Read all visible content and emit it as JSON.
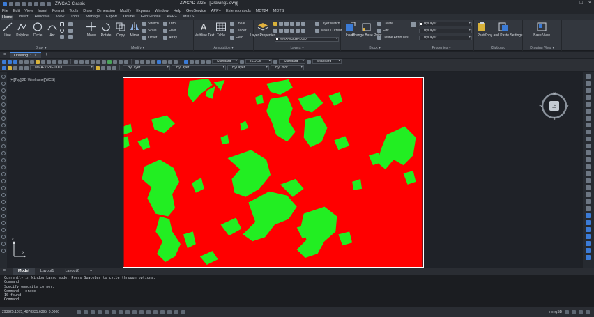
{
  "titlebar": {
    "workspace": "ZWCAD Classic",
    "title": "ZWCAD 2025 - [Drawing1.dwg]"
  },
  "menubar": [
    "File",
    "Edit",
    "View",
    "Insert",
    "Format",
    "Tools",
    "Draw",
    "Dimension",
    "Modify",
    "Express",
    "Window",
    "Help",
    "GeoService",
    "APP+",
    "Extensiontools",
    "MDT24",
    "MDTS"
  ],
  "ribbontabs": [
    "Home",
    "Insert",
    "Annotate",
    "View",
    "Tools",
    "Manage",
    "Export",
    "Online",
    "GeoService",
    "APP+",
    "MDTS"
  ],
  "ribbon": {
    "draw": {
      "label": "Draw",
      "buttons": [
        "Line",
        "Polyline",
        "Circle",
        "Arc"
      ]
    },
    "modify": {
      "label": "Modify",
      "big": [
        "Move",
        "Rotate",
        "Copy",
        "Mirror"
      ],
      "small": [
        "Stretch",
        "Scale",
        "Offset",
        "Trim",
        "Fillet",
        "Array"
      ]
    },
    "annotation": {
      "label": "Annotation",
      "big": [
        "Multiline Text",
        "Table"
      ],
      "small": [
        "Linear",
        "Leader",
        "Field"
      ]
    },
    "layers": {
      "label": "Layers",
      "big": "Layer Properties",
      "small": [
        "Layer Match",
        "Make Current"
      ],
      "combo": "MMA-VSBE-DXD"
    },
    "block": {
      "label": "Block",
      "big": [
        "Insert",
        "Change Base Point"
      ],
      "small": [
        "Create",
        "Edit",
        "Define Attributes"
      ]
    },
    "properties": {
      "label": "Properties",
      "combos": [
        "ByLayer",
        "ByLayer",
        "ByLayer"
      ]
    },
    "clipboard": {
      "label": "Clipboard",
      "big": [
        "Paste",
        "Copy and Paste Settings"
      ]
    },
    "drawingview": {
      "label": "Drawing View",
      "big": "Base View"
    }
  },
  "doctab": {
    "name": "Drawing1*",
    "close": "×",
    "plus": "+"
  },
  "toolrow": {
    "row1": [
      "Standard",
      "ISO-25",
      "Standard",
      "Standard"
    ],
    "row2": [
      "MMA-VSBE-DXD",
      "ByLayer",
      "ByLayer",
      "ByLayer",
      "ByColor"
    ]
  },
  "viewport_label": "[+][Top][2D Wireframe][WCS]",
  "navcube": {
    "face": "上",
    "n": "N",
    "s": "S",
    "e": "E",
    "w": "W"
  },
  "ucs": {
    "y": "Y",
    "x": "X"
  },
  "layouttabs": [
    "Model",
    "Layout1",
    "Layout2",
    "+"
  ],
  "cmdlines": [
    "Currently in Window Lasso mode. Press Spacebar to cycle through options.",
    "Command:",
    "Specify opposite corner:",
    "Command:  .erase",
    "10 found",
    "Command:"
  ],
  "status": {
    "coords": "293925.1075, 4878331.6395, 0.0000",
    "right": "mmgSB"
  },
  "colors": {
    "drawing_bg": "#ff0000",
    "vegetation": "#22ee22"
  }
}
